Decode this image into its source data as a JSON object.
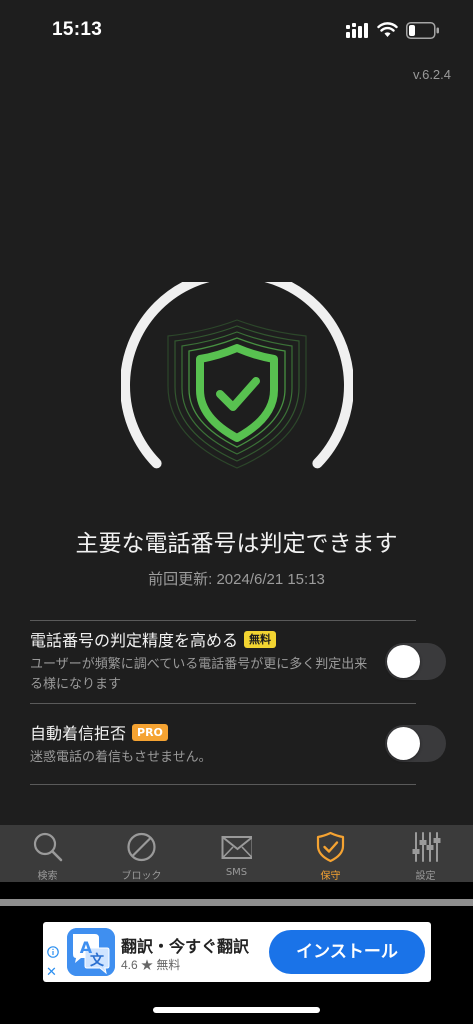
{
  "status_bar": {
    "time": "15:13"
  },
  "app": {
    "version": "v.6.2.4",
    "main_title": "主要な電話番号は判定できます",
    "last_update": "前回更新: 2024/6/21 15:13"
  },
  "settings": [
    {
      "title": "電話番号の判定精度を高める",
      "badge": "無料",
      "description": "ユーザーが頻繁に調べている電話番号が更に多く判定出来る様になります",
      "enabled": false
    },
    {
      "title": "自動着信拒否",
      "badge": "PRO",
      "description": "迷惑電話の着信もさせません。",
      "enabled": false
    }
  ],
  "tabbar": {
    "tabs": [
      {
        "label": "検索",
        "icon": "search-icon",
        "active": false
      },
      {
        "label": "ブロック",
        "icon": "block-icon",
        "active": false
      },
      {
        "label": "SMS",
        "icon": "mail-icon",
        "active": false
      },
      {
        "label": "保守",
        "icon": "shield-check-icon",
        "active": true
      },
      {
        "label": "設定",
        "icon": "sliders-icon",
        "active": false
      }
    ]
  },
  "ad": {
    "app_name": "翻訳・今すぐ翻訳",
    "rating": "4.6 ★ 無料",
    "install_label": "インストール",
    "icon_letters": {
      "a": "A",
      "b": "文"
    }
  },
  "colors": {
    "background": "#1e1e1e",
    "accent": "#f5a332",
    "shield_green": "#58c150",
    "install_blue": "#1a73e8"
  }
}
